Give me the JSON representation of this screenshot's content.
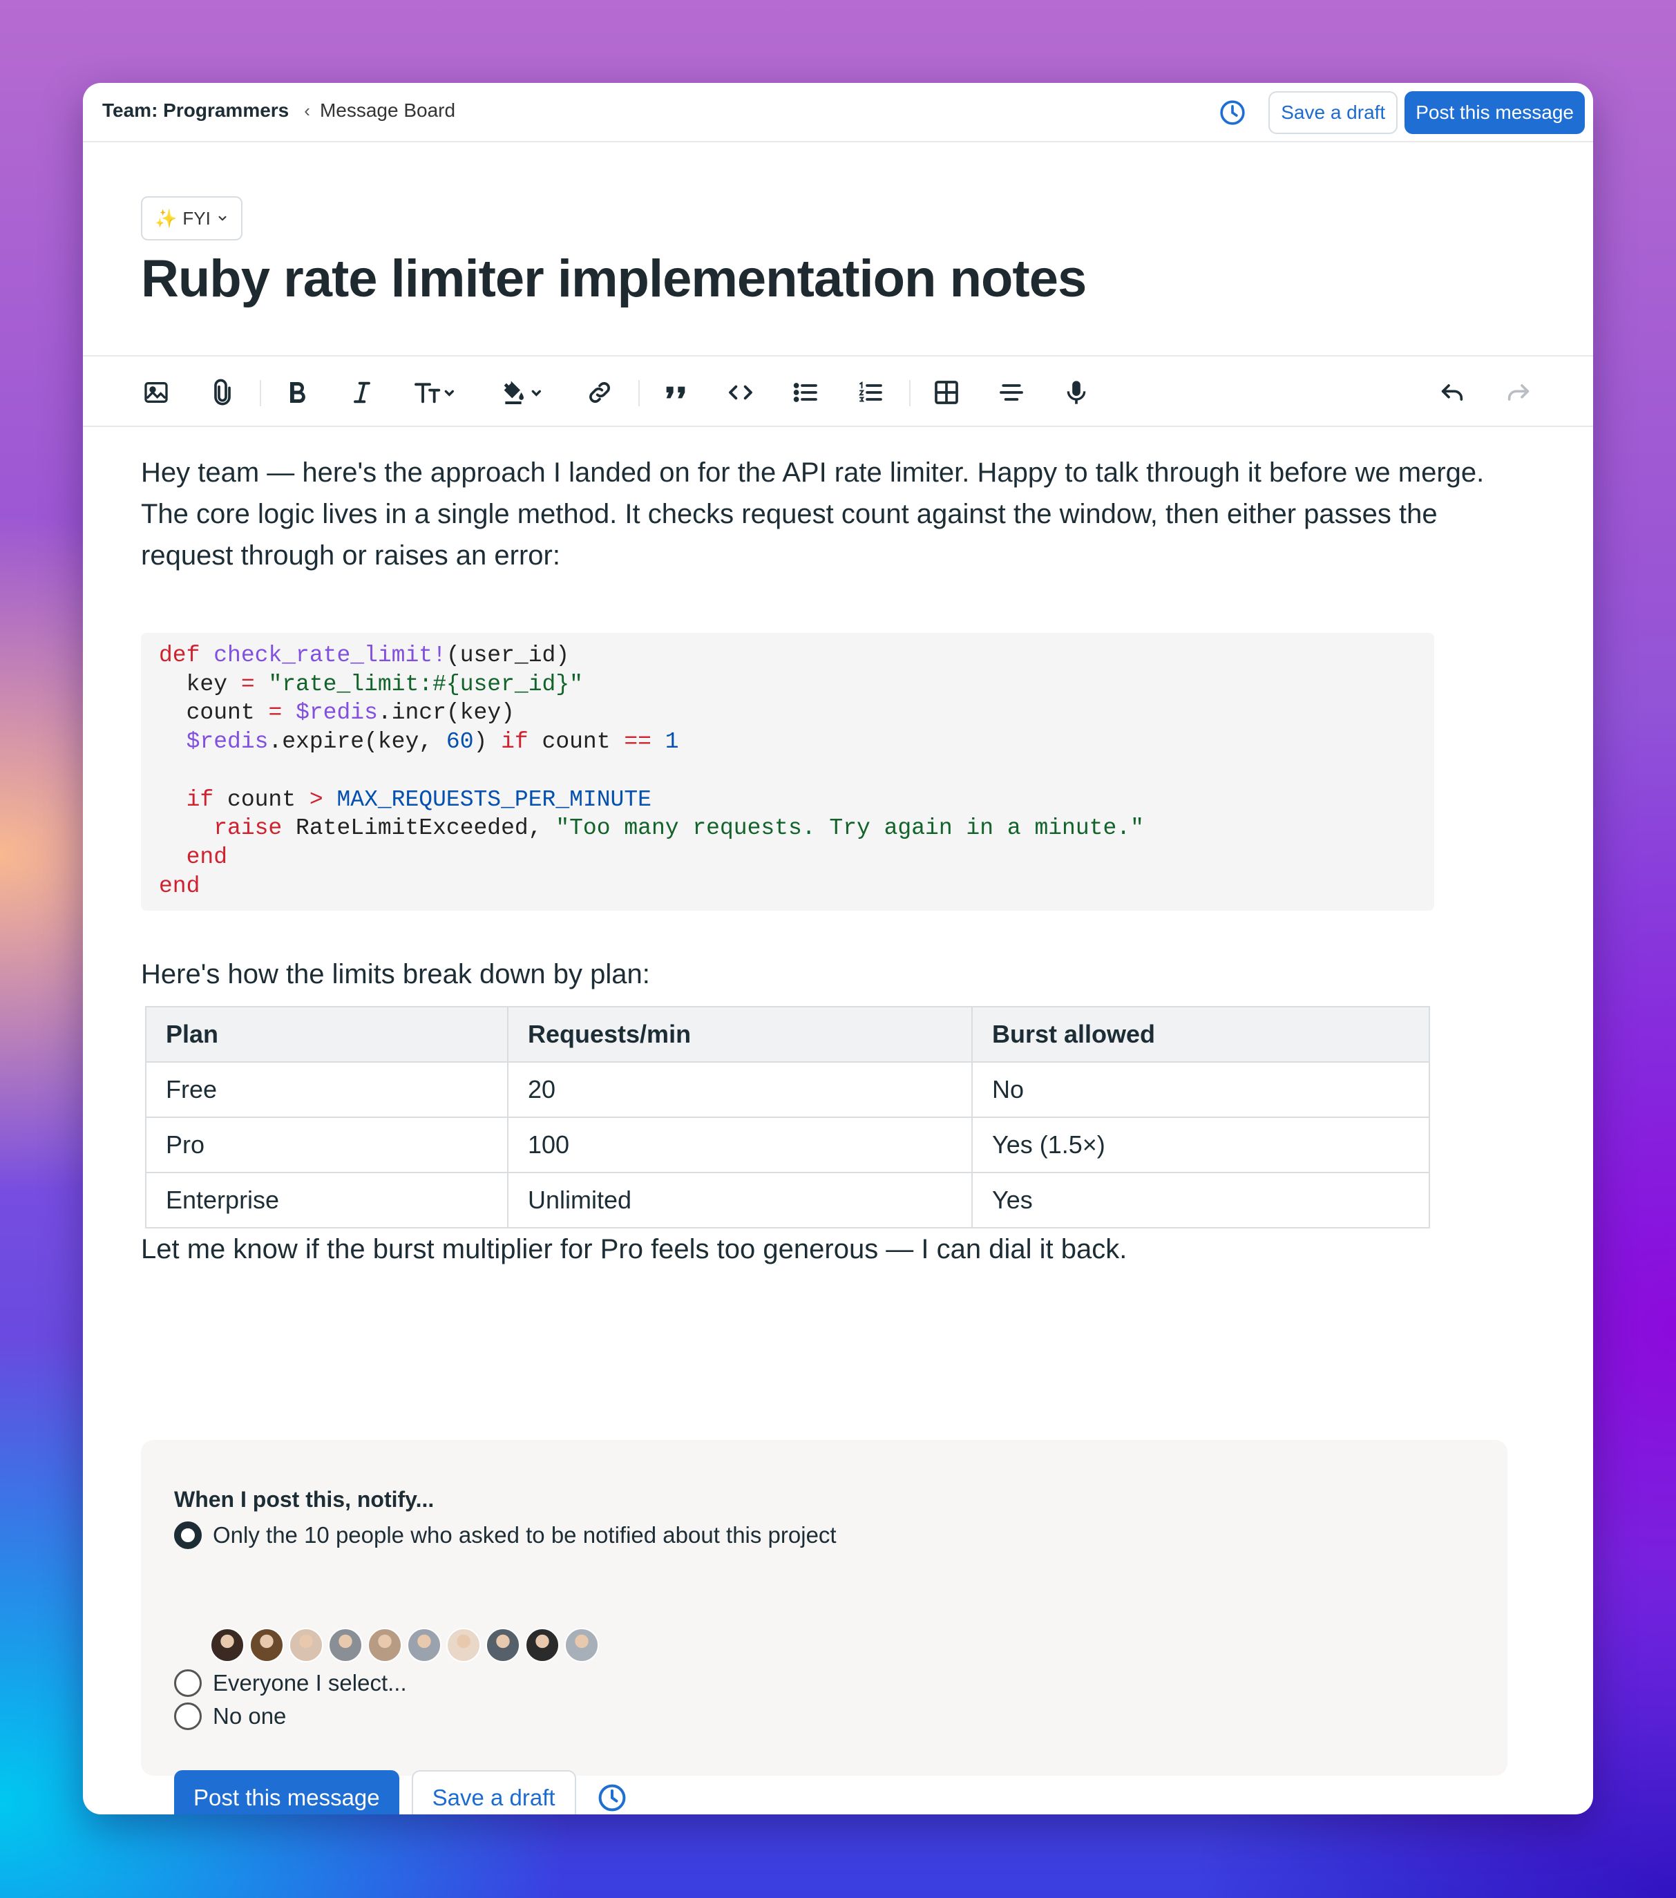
{
  "breadcrumb": {
    "team": "Team: Programmers",
    "separator": "‹",
    "board": "Message Board"
  },
  "top_actions": {
    "save_draft": "Save a draft",
    "post": "Post this message"
  },
  "category": {
    "icon": "sparkles-icon",
    "label": "FYI"
  },
  "title": "Ruby rate limiter implementation notes",
  "toolbar": {
    "icons": [
      "image-icon",
      "paperclip-icon",
      "bold-icon",
      "italic-icon",
      "text-size-icon",
      "highlight-icon",
      "link-icon",
      "quote-icon",
      "code-icon",
      "bullet-list-icon",
      "numbered-list-icon",
      "table-icon",
      "divider-icon",
      "microphone-icon",
      "undo-icon",
      "redo-icon"
    ]
  },
  "body": {
    "para1": "Hey team — here's the approach I landed on for the API rate limiter. Happy to talk through it before we merge.",
    "para2": "The core logic lives in a single method. It checks request count against the window, then either passes the request through or raises an error:",
    "plan_intro": "Here's how the limits break down by plan:",
    "outro": "Let me know if the burst multiplier for Pro feels too generous — I can dial it back."
  },
  "code": {
    "language": "ruby",
    "lines": [
      "def check_rate_limit!(user_id)",
      "  key = \"rate_limit:#{user_id}\"",
      "  count = $redis.incr(key)",
      "  $redis.expire(key, 60) if count == 1",
      "",
      "  if count > MAX_REQUESTS_PER_MINUTE",
      "    raise RateLimitExceeded, \"Too many requests. Try again in a minute.\"",
      "  end",
      "end"
    ]
  },
  "plans_table": {
    "headers": [
      "Plan",
      "Requests/min",
      "Burst allowed"
    ],
    "rows": [
      [
        "Free",
        "20",
        "No"
      ],
      [
        "Pro",
        "100",
        "Yes (1.5×)"
      ],
      [
        "Enterprise",
        "Unlimited",
        "Yes"
      ]
    ]
  },
  "notify": {
    "title": "When I post this, notify...",
    "options": [
      {
        "label": "Only the 10 people who asked to be notified about this project",
        "selected": true
      },
      {
        "label": "Everyone I select...",
        "selected": false
      },
      {
        "label": "No one",
        "selected": false
      }
    ],
    "avatar_colors": [
      "#3a2a22",
      "#6b4a2c",
      "#d9c3b0",
      "#8a8f95",
      "#b79b82",
      "#9aa3ad",
      "#e9d7c8",
      "#56606a",
      "#2b2b2b",
      "#a7b0b8"
    ],
    "post": "Post this message",
    "save_draft": "Save a draft"
  },
  "colors": {
    "accent": "#1f6ed4",
    "text": "#1d2d35"
  }
}
